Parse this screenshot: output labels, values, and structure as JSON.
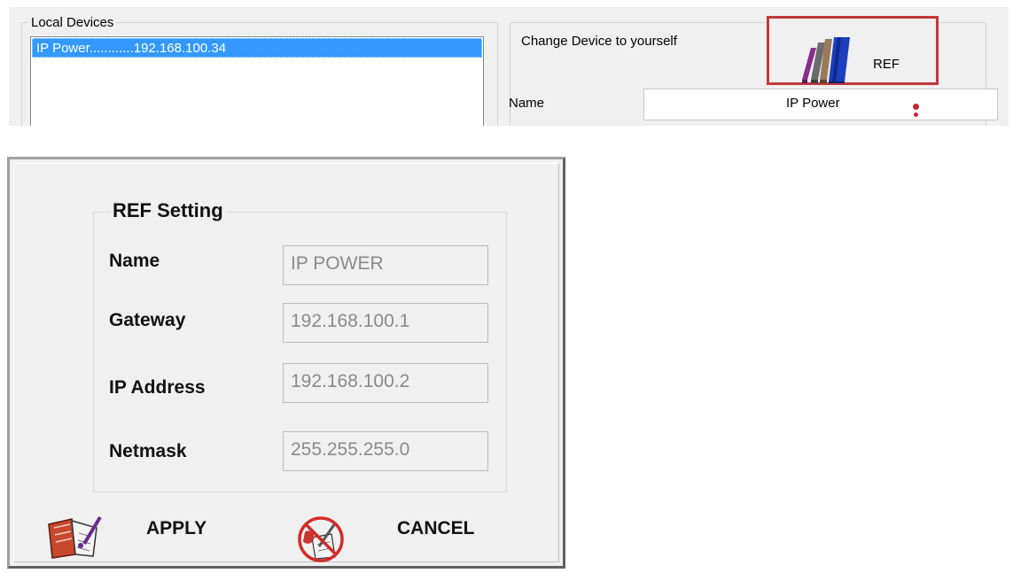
{
  "local_devices": {
    "title": "Local Devices",
    "items": [
      {
        "label": "IP Power............192.168.100.34",
        "selected": true
      }
    ]
  },
  "change_device": {
    "title": "Change Device to yourself",
    "ref_button": {
      "label": "REF",
      "icon": "books-icon"
    },
    "name_label": "Name",
    "name_value": "IP Power"
  },
  "ref_dialog": {
    "group_title": "REF Setting",
    "fields": [
      {
        "label": "Name",
        "value": "IP POWER"
      },
      {
        "label": "Gateway",
        "value": "192.168.100.1"
      },
      {
        "label": "IP Address",
        "value": "192.168.100.2"
      },
      {
        "label": "Netmask",
        "value": "255.255.255.0"
      }
    ],
    "apply": {
      "label": "APPLY",
      "icon": "notebook-pen-icon"
    },
    "cancel": {
      "label": "CANCEL",
      "icon": "cancel-prohibited-icon"
    }
  },
  "colors": {
    "selection": "#3399ff",
    "highlight_border": "#c0383c",
    "window_bg": "#f0f0f0",
    "disabled_text": "#8a8a8a"
  }
}
